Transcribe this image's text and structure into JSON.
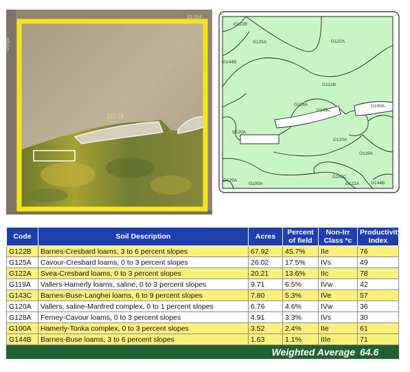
{
  "aerial": {
    "field_id": "157-29",
    "plss_code": "33-154",
    "corner_text": "Google"
  },
  "soil_map": {
    "labels": [
      "G122B",
      "G125A",
      "G122A",
      "G144B",
      "G122B",
      "G128A",
      "G143C",
      "G100A",
      "G120A",
      "G120A",
      "G119A",
      "G125A",
      "G100A",
      "G143C",
      "G122A",
      "G144B"
    ]
  },
  "table": {
    "headers": {
      "code": "Code",
      "description": "Soil Description",
      "acres": "Acres",
      "percent_line1": "Percent",
      "percent_line2": "of field",
      "class_line1": "Non-Irr",
      "class_line2": "Class *c",
      "productivity_line1": "Productivity",
      "productivity_line2": "Index"
    },
    "rows": [
      {
        "code": "G122B",
        "description": "Barnes-Cresbard loams, 3 to 6 percent slopes",
        "acres": "67.92",
        "percent": "45.7%",
        "class": "IIe",
        "index": "76"
      },
      {
        "code": "G125A",
        "description": "Cavour-Cresbard loams, 0 to 3 percent slopes",
        "acres": "26.02",
        "percent": "17.5%",
        "class": "IVs",
        "index": "49"
      },
      {
        "code": "G122A",
        "description": "Svea-Cresbard loams, 0 to 3 percent slopes",
        "acres": "20.21",
        "percent": "13.6%",
        "class": "IIc",
        "index": "78"
      },
      {
        "code": "G119A",
        "description": "Vallers-Hamerly loams, saline, 0 to 3 percent slopes",
        "acres": "9.71",
        "percent": "6.5%",
        "class": "IVw",
        "index": "42"
      },
      {
        "code": "G143C",
        "description": "Barnes-Buse-Langhei loams, 6 to 9 percent slopes",
        "acres": "7.80",
        "percent": "5.3%",
        "class": "IVe",
        "index": "57"
      },
      {
        "code": "G120A",
        "description": "Vallers, saline-Manfred complex, 0 to 1 percent slopes",
        "acres": "6.76",
        "percent": "4.6%",
        "class": "IVw",
        "index": "36"
      },
      {
        "code": "G128A",
        "description": "Ferney-Cavour loams, 0 to 3 percent slopes",
        "acres": "4.91",
        "percent": "3.3%",
        "class": "IVs",
        "index": "30"
      },
      {
        "code": "G100A",
        "description": "Hamerly-Tonka complex, 0 to 3 percent slopes",
        "acres": "3.52",
        "percent": "2.4%",
        "class": "IIe",
        "index": "61"
      },
      {
        "code": "G144B",
        "description": "Barnes-Buse loams, 3 to 6 percent slopes",
        "acres": "1.63",
        "percent": "1.1%",
        "class": "IIIe",
        "index": "71"
      }
    ],
    "weighted_average_label": "Weighted Average",
    "weighted_average_value": "64.6"
  },
  "colors": {
    "header_bg": "#1f3fae",
    "highlight_row": "#fbf07a",
    "footer_bg": "#216232",
    "field_border": "#f6e51c",
    "soil_fill": "#c8f5c4"
  }
}
